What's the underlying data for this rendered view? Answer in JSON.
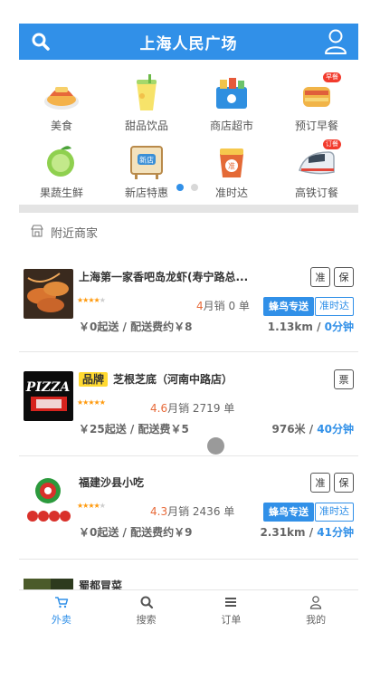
{
  "header": {
    "title": "上海人民广场"
  },
  "categories": [
    {
      "label": "美食",
      "icon": "food-icon"
    },
    {
      "label": "甜品饮品",
      "icon": "dessert-drink-icon"
    },
    {
      "label": "商店超市",
      "icon": "supermarket-icon"
    },
    {
      "label": "预订早餐",
      "icon": "breakfast-icon",
      "badge": "早餐"
    },
    {
      "label": "果蔬生鲜",
      "icon": "fruit-veg-icon"
    },
    {
      "label": "新店特惠",
      "icon": "new-shop-icon",
      "badge_text": "新店"
    },
    {
      "label": "准时达",
      "icon": "on-time-icon",
      "badge_text": "准"
    },
    {
      "label": "高铁订餐",
      "icon": "train-icon",
      "badge": "订餐"
    }
  ],
  "carousel": {
    "pages": 2,
    "active_page": 1
  },
  "nearby": {
    "title": "附近商家"
  },
  "shops": [
    {
      "name": "上海第一家香吧岛龙虾(寿宁路总...",
      "brand": "",
      "tags": [
        "准",
        "保"
      ],
      "rating": 4.0,
      "score": "4",
      "sales": "月销 0 单",
      "fengniao": "蜂鸟专送",
      "zhunshida": "准时达",
      "fee": "￥0起送 / 配送费约￥8",
      "distance": "1.13km / ",
      "time": "0分钟"
    },
    {
      "name": "芝根芝底（河南中路店）",
      "brand": "品牌",
      "tags": [
        "票"
      ],
      "rating": 4.6,
      "score": "4.6",
      "sales": "月销 2719 单",
      "fengniao": "",
      "zhunshida": "",
      "fee": "￥25起送 / 配送费￥5",
      "distance": "976米 / ",
      "time": "40分钟"
    },
    {
      "name": "福建沙县小吃",
      "brand": "",
      "tags": [
        "准",
        "保"
      ],
      "rating": 4.3,
      "score": "4.3",
      "sales": "月销 2436 单",
      "fengniao": "蜂鸟专送",
      "zhunshida": "准时达",
      "fee": "￥0起送 / 配送费约￥9",
      "distance": "2.31km / ",
      "time": "41分钟"
    },
    {
      "name": "蜀都冒菜"
    }
  ],
  "bottom_nav": [
    {
      "label": "外卖",
      "icon": "takeout-icon",
      "active": true
    },
    {
      "label": "搜索",
      "icon": "search-icon",
      "active": false
    },
    {
      "label": "订单",
      "icon": "order-list-icon",
      "active": false
    },
    {
      "label": "我的",
      "icon": "profile-icon",
      "active": false
    }
  ],
  "colors": {
    "primary": "#3190e8",
    "brand_badge": "#ffd930",
    "star": "#ff9a0d",
    "score": "#e86b3a"
  }
}
